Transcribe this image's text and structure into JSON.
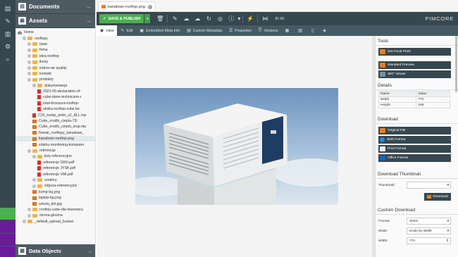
{
  "app": {
    "brand": "PIMCORE"
  },
  "tree": {
    "documents_title": "Documents",
    "assets_title": "Assets",
    "data_objects_title": "Data Objects",
    "nodes": [
      {
        "depth": 0,
        "kind": "home",
        "label": "Home"
      },
      {
        "depth": 1,
        "kind": "folder",
        "toggle": "−",
        "label": "rooftopy"
      },
      {
        "depth": 2,
        "kind": "folder",
        "toggle": "+",
        "label": "base"
      },
      {
        "depth": 2,
        "kind": "folder",
        "toggle": "+",
        "label": "firma"
      },
      {
        "depth": 2,
        "kind": "folder",
        "toggle": "+",
        "label": "idea-rooftop"
      },
      {
        "depth": 2,
        "kind": "folder",
        "toggle": "+",
        "label": "ikony"
      },
      {
        "depth": 2,
        "kind": "folder",
        "toggle": "+",
        "label": "indoor-air-quality"
      },
      {
        "depth": 2,
        "kind": "folder",
        "toggle": "+",
        "label": "kontakt"
      },
      {
        "depth": 2,
        "kind": "folder",
        "toggle": "−",
        "label": "produkty"
      },
      {
        "depth": 3,
        "kind": "folder",
        "toggle": "−",
        "label": "dokumentacja"
      },
      {
        "depth": 4,
        "kind": "pdf",
        "label": "2021-05-declaration-of-"
      },
      {
        "depth": 4,
        "kind": "pdf",
        "label": "cube-dane-techniczne-r"
      },
      {
        "depth": 4,
        "kind": "pdf",
        "label": "total-broszura-rooftop-"
      },
      {
        "depth": 4,
        "kind": "pdf",
        "label": "ulotka-rooftop-cube.be"
      },
      {
        "depth": 3,
        "kind": "pdf",
        "label": "C20_komp_anim_v2_ALL.mp"
      },
      {
        "depth": 3,
        "kind": "image",
        "label": "Cube_zrodlo_ciepla-72i"
      },
      {
        "depth": 3,
        "kind": "image",
        "label": "Cube_zrodlo_ciepla_loop.mp"
      },
      {
        "depth": 3,
        "kind": "image",
        "label": "flowair_rooftopy_kanalowe_"
      },
      {
        "depth": 3,
        "kind": "image",
        "label": "kanalowe-rooftop.png",
        "selected": true
      },
      {
        "depth": 3,
        "kind": "image",
        "label": "zdalny-monitoring-komputer"
      },
      {
        "depth": 2,
        "kind": "folder",
        "toggle": "−",
        "label": "referencje"
      },
      {
        "depth": 3,
        "kind": "folder",
        "toggle": "−",
        "label": "listy referencyjne"
      },
      {
        "depth": 4,
        "kind": "pdf",
        "label": "referencje GKN.pdf"
      },
      {
        "depth": 4,
        "kind": "pdf",
        "label": "referencje JYSK.pdf"
      },
      {
        "depth": 4,
        "kind": "pdf",
        "label": "referencje VMI.pdf"
      },
      {
        "depth": 3,
        "kind": "folder",
        "toggle": "+",
        "label": "rendery"
      },
      {
        "depth": 3,
        "kind": "folder",
        "toggle": "+",
        "label": "zdjecia-referencyjne"
      },
      {
        "depth": 3,
        "kind": "image",
        "label": "komp-bg.png"
      },
      {
        "depth": 3,
        "kind": "image",
        "label": "laptop-bg.png"
      },
      {
        "depth": 3,
        "kind": "image",
        "label": "szkola_krk.jpg"
      },
      {
        "depth": 2,
        "kind": "folder",
        "toggle": "+",
        "label": "rooftop-cube-dla-inwestora"
      },
      {
        "depth": 2,
        "kind": "folder",
        "toggle": "+",
        "label": "strona-glowna"
      },
      {
        "depth": 1,
        "kind": "folder",
        "toggle": "+",
        "label": "_default_upload_bucket"
      }
    ]
  },
  "tabs": [
    {
      "label": "kanalowe-rooftop.png"
    }
  ],
  "toolbar": {
    "save_label": "SAVE & PUBLISH",
    "id_label": "ID 85"
  },
  "subtabs": [
    {
      "icon": "eye-icon",
      "glyph": "◉",
      "label": "View",
      "active": true
    },
    {
      "icon": "pencil-icon",
      "glyph": "✎",
      "label": "Edit"
    },
    {
      "icon": "image-icon",
      "glyph": "▣",
      "label": "Embedded Meta Info"
    },
    {
      "icon": "metadata-icon",
      "glyph": "▤",
      "label": "Custom Metadata"
    },
    {
      "icon": "sliders-icon",
      "glyph": "☰",
      "label": "Properties"
    },
    {
      "icon": "versions-icon",
      "glyph": "⎘",
      "label": "Versions"
    },
    {
      "icon": "calendar-icon",
      "glyph": "▦",
      "label": ""
    },
    {
      "icon": "schedule-icon",
      "glyph": "▥",
      "label": ""
    },
    {
      "icon": "notes-icon",
      "glyph": "▯",
      "label": ""
    },
    {
      "icon": "tag-icon",
      "glyph": "◈",
      "label": ""
    }
  ],
  "side": {
    "tools_title": "Tools",
    "set_focal_point": "Set Focal Point",
    "standard_preview": "Standard Preview",
    "viewer_360": "360° Viewer",
    "details_title": "Details",
    "details_headers": [
      "Name",
      "Value"
    ],
    "details_rows": [
      [
        "Width",
        "770"
      ],
      [
        "Height",
        "448"
      ]
    ],
    "download_title": "Download",
    "download_original": "Original File",
    "download_web": "Web Format",
    "download_print": "Print Format",
    "download_office": "Office Format",
    "thumb_title": "Download Thumbnail",
    "thumbnail_label": "Thumbnail:",
    "thumbnail_value": "",
    "download_btn": "Download",
    "custom_title": "Custom Download",
    "format_label": "Format:",
    "format_value": "JPEG",
    "mode_label": "Mode:",
    "mode_value": "Scale by Width",
    "width_label": "Width:",
    "width_value": "770"
  },
  "colors": {
    "rail": "#37474f",
    "accent_green": "#4caf50",
    "folder": "#f0b347",
    "pdf": "#d32f2f",
    "image": "#e67e22"
  }
}
